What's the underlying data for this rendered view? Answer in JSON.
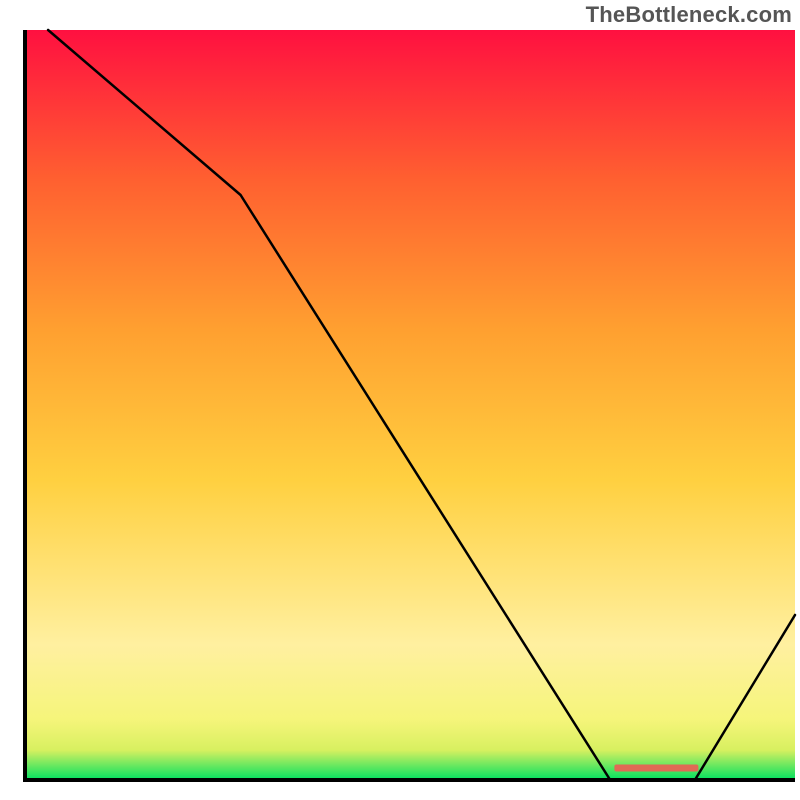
{
  "watermark": "TheBottleneck.com",
  "chart_data": {
    "type": "line",
    "title": "",
    "xlabel": "",
    "ylabel": "",
    "xlim": [
      0,
      100
    ],
    "ylim": [
      0,
      100
    ],
    "x": [
      3,
      28,
      76,
      87,
      100
    ],
    "y": [
      100,
      78,
      0,
      0,
      22
    ],
    "annotations": [
      {
        "text": "▬▬▬▬",
        "x": 82,
        "y": 1
      }
    ],
    "gradient_stops": [
      {
        "offset": 0.0,
        "color": "#00e060"
      },
      {
        "offset": 0.04,
        "color": "#d8f060"
      },
      {
        "offset": 0.08,
        "color": "#f5f57a"
      },
      {
        "offset": 0.18,
        "color": "#fff0a0"
      },
      {
        "offset": 0.4,
        "color": "#ffd040"
      },
      {
        "offset": 0.6,
        "color": "#ffa030"
      },
      {
        "offset": 0.8,
        "color": "#ff6030"
      },
      {
        "offset": 1.0,
        "color": "#ff1040"
      }
    ]
  }
}
